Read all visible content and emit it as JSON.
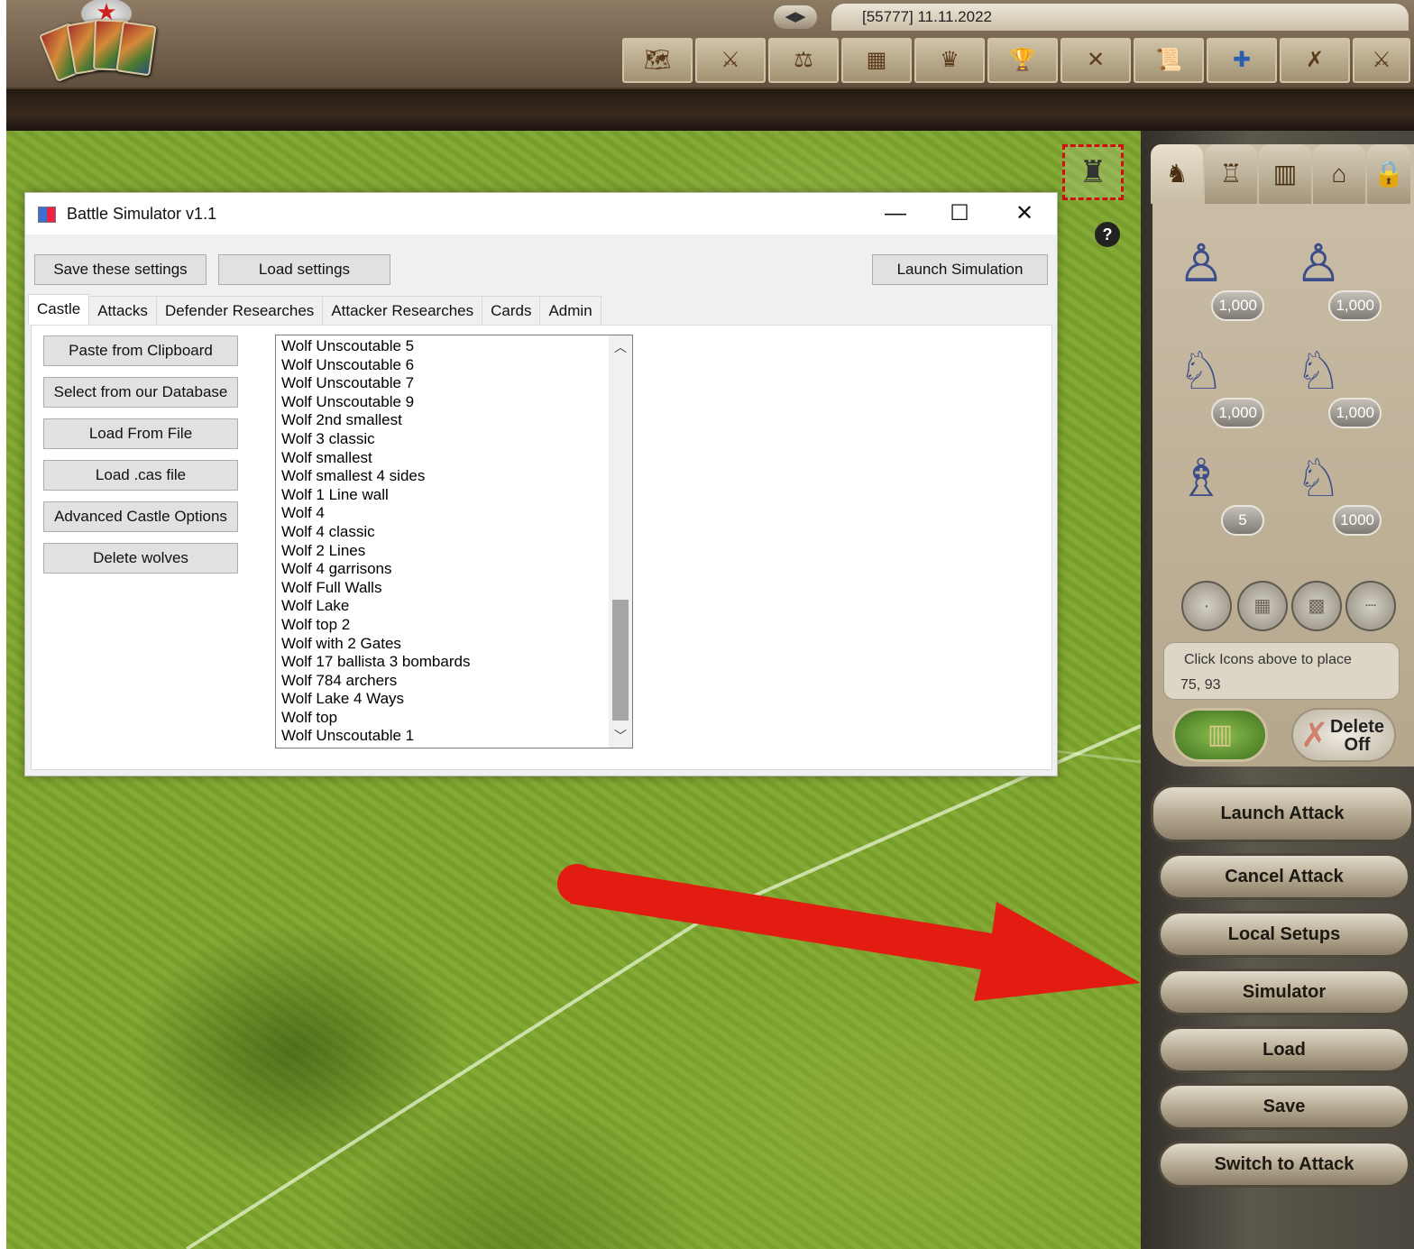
{
  "colors": {
    "accent_red": "#e31c12",
    "grass": "#7ea52e",
    "panel_stone": "#b5a78c"
  },
  "game": {
    "date_label": "[55777] 11.11.2022",
    "nav_arrows": "◀▶",
    "toolbar_icons": [
      "world-map-icon",
      "army-icon",
      "trade-icon",
      "castle-layout-icon",
      "crown-icon",
      "trophy-icon",
      "sword-icon",
      "scroll-icon",
      "flag-icon",
      "crossed-swords-icon",
      "army-2-icon"
    ]
  },
  "dialog": {
    "title": "Battle Simulator v1.1",
    "save_settings": "Save these settings",
    "load_settings": "Load settings",
    "launch_simulation": "Launch Simulation",
    "minimize": "—",
    "maximize": "☐",
    "close": "✕",
    "tabs": [
      "Castle",
      "Attacks",
      "Defender Researches",
      "Attacker Researches",
      "Cards",
      "Admin"
    ],
    "castle_buttons": [
      "Paste from Clipboard",
      "Select from our Database",
      "Load From File",
      "Load .cas file",
      "Advanced Castle Options",
      "Delete wolves"
    ],
    "castle_list": [
      "Wolf Unscoutable 5",
      "Wolf Unscoutable 6",
      "Wolf Unscoutable 7",
      "Wolf Unscoutable 9",
      "Wolf 2nd smallest",
      "Wolf 3 classic",
      "Wolf smallest",
      "Wolf smallest 4 sides",
      "Wolf 1 Line wall",
      "Wolf 4",
      "Wolf 4 classic",
      "Wolf 2 Lines",
      "Wolf 4 garrisons",
      "Wolf Full Walls",
      "Wolf Lake",
      "Wolf top 2",
      "Wolf with 2 Gates",
      "Wolf 17 ballista 3 bombards",
      "Wolf 784 archers",
      "Wolf Lake 4 Ways",
      "Wolf top",
      "Wolf Unscoutable 1"
    ]
  },
  "panel": {
    "unit_counts": [
      "1,000",
      "1,000",
      "1,000",
      "1,000",
      "5",
      "1000"
    ],
    "hint": "Click Icons above to place",
    "coords": "75, 93",
    "delete_label": "Delete",
    "delete_state": "Off",
    "buttons": {
      "launch_attack": "Launch Attack",
      "cancel_attack": "Cancel Attack",
      "local_setups": "Local Setups",
      "simulator": "Simulator",
      "load": "Load",
      "save": "Save",
      "switch_to_attack": "Switch to Attack"
    }
  }
}
